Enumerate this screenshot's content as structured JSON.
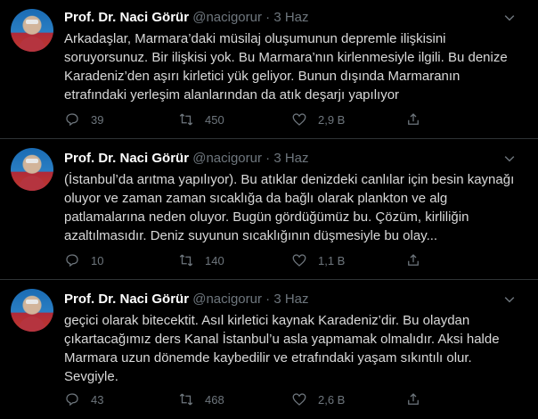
{
  "tweets": [
    {
      "name": "Prof. Dr. Naci Görür",
      "handle": "@nacigorur",
      "dot": "·",
      "date": "3 Haz",
      "text": "Arkadaşlar, Marmara’daki müsilaj oluşumunun depremle ilişkisini\nsoruyorsunuz. Bir ilişkisi yok. Bu Marmara’nın kirlenmesiyle ilgili. Bu denize\nKaradeniz’den aşırı kirletici yük geliyor. Bunun dışında Marmaranın\netrafındaki yerleşim alanlarından da atık deşarjı yapılıyor",
      "replies": "39",
      "retweets": "450",
      "likes": "2,9 B"
    },
    {
      "name": "Prof. Dr. Naci Görür",
      "handle": "@nacigorur",
      "dot": "·",
      "date": "3 Haz",
      "text": "(İstanbul’da arıtma yapılıyor). Bu atıklar denizdeki canlılar için besin kaynağı\noluyor ve zaman zaman sıcaklığa da bağlı olarak plankton ve alg\npatlamalarına neden oluyor. Bugün gördüğümüz bu. Çözüm, kirliliğin\nazaltılmasıdır. Deniz suyunun sıcaklığının düşmesiyle bu olay...",
      "replies": "10",
      "retweets": "140",
      "likes": "1,1 B"
    },
    {
      "name": "Prof. Dr. Naci Görür",
      "handle": "@nacigorur",
      "dot": "·",
      "date": "3 Haz",
      "text": "geçici olarak bitecektit. Asıl kirletici kaynak Karadeniz’dir. Bu olaydan\nçıkartacağımız ders Kanal İstanbul’u asla yapmamak olmalıdır. Aksi halde\nMarmara uzun dönemde kaybedilir ve etrafındaki yaşam sıkıntılı olur.\nSevgiyle.",
      "replies": "43",
      "retweets": "468",
      "likes": "2,6 B"
    }
  ],
  "colors": {
    "background": "#000000",
    "text": "#d9d9d9",
    "name": "#ffffff",
    "muted": "#6e767d",
    "divider": "#2f3336"
  },
  "icons": [
    "chevron-down-icon",
    "reply-icon",
    "retweet-icon",
    "like-icon",
    "share-icon"
  ]
}
